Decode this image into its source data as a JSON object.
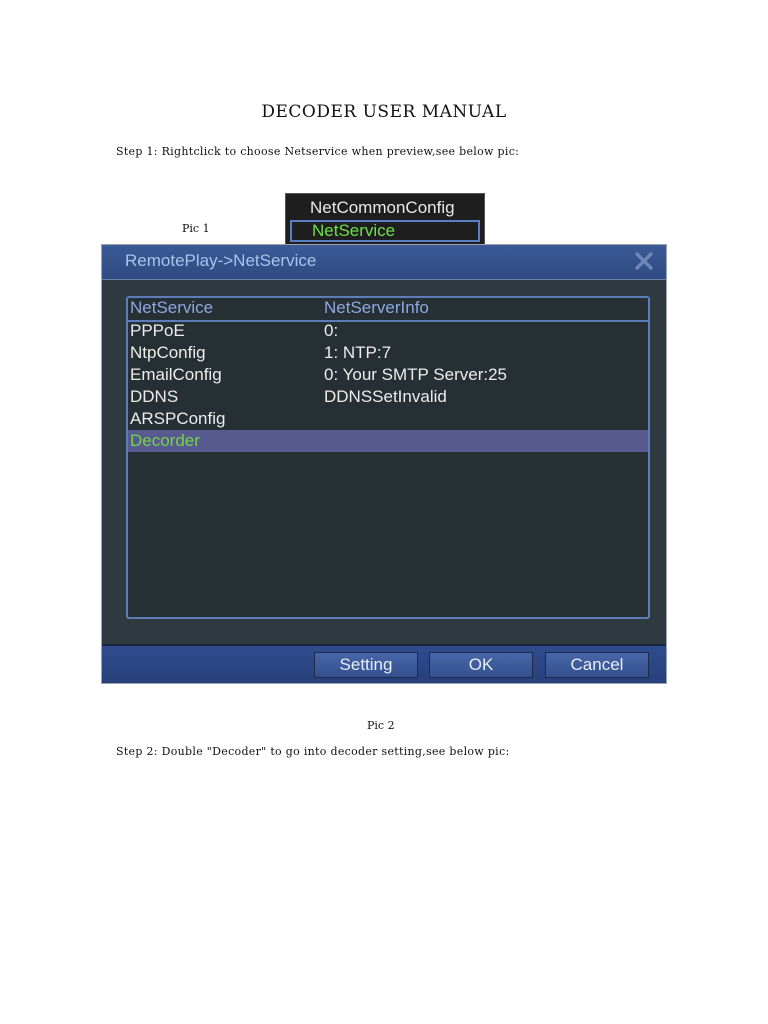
{
  "document": {
    "title": "DECODER USER MANUAL",
    "step1": "Step 1: Rightclick to choose Netservice when preview,see below pic:",
    "pic1_caption": "Pic 1",
    "pic2_caption": "Pic 2",
    "step2": "Step 2: Double \"Decoder\" to go into decoder setting,see below pic:"
  },
  "context_menu": {
    "items": [
      {
        "label": "NetCommonConfig"
      },
      {
        "label": "NetService",
        "selected": true
      }
    ]
  },
  "dialog": {
    "title": "RemotePlay->NetService",
    "close_icon": "close-icon",
    "columns": [
      "NetService",
      "NetServerInfo"
    ],
    "rows": [
      {
        "service": "PPPoE",
        "info": "0:"
      },
      {
        "service": "NtpConfig",
        "info": "1: NTP:7"
      },
      {
        "service": "EmailConfig",
        "info": "0: Your SMTP Server:25"
      },
      {
        "service": "DDNS",
        "info": "DDNSSetInvalid"
      },
      {
        "service": "ARSPConfig",
        "info": ""
      },
      {
        "service": "Decorder",
        "info": "",
        "selected": true
      }
    ],
    "buttons": {
      "setting": "Setting",
      "ok": "OK",
      "cancel": "Cancel"
    }
  },
  "colors": {
    "selected_text": "#76d34a",
    "selected_row_bg": "#565a8e",
    "titlebar_bg": "#3b5a96",
    "panel_bg": "#2e3a40"
  }
}
